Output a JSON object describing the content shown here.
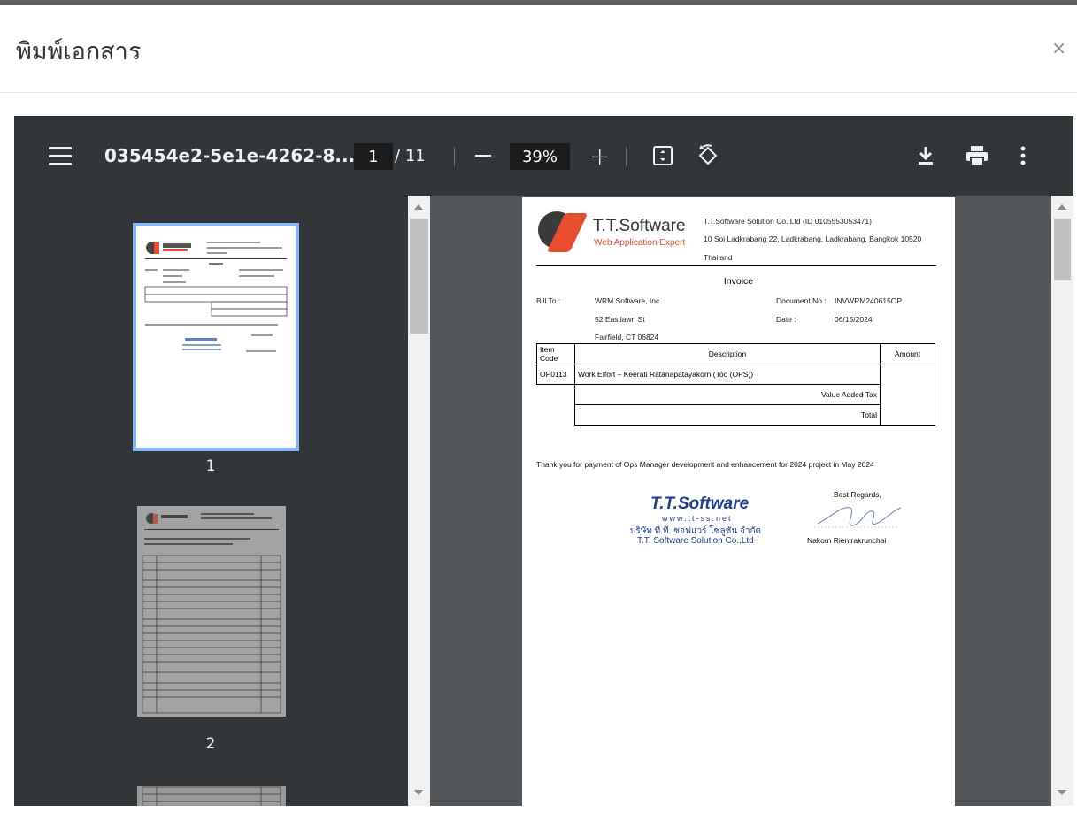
{
  "modal": {
    "title": "พิมพ์เอกสาร",
    "close_label": "×"
  },
  "toolbar": {
    "file_name": "035454e2-5e1e-4262-8...",
    "page_current": "1",
    "page_total": "/ 11",
    "zoom": "39%",
    "zoom_in_label": "+"
  },
  "sidebar": {
    "thumbnails": [
      {
        "label": "1"
      },
      {
        "label": "2"
      }
    ]
  },
  "document": {
    "brand_name": "T.T.Software",
    "brand_tagline": "Web Application Expert",
    "company_line1": "T.T.Software Solution Co.,Ltd (ID 0105553053471)",
    "company_line2": "10 Soi Ladkrabang 22, Ladkrabang, Ladkrabang, Bangkok 10520",
    "company_line3": "Thailand",
    "title": "Invoice",
    "bill_to_label": "Bill To :",
    "bill_to_name": "WRM Software, Inc",
    "bill_to_address1": "52 Eastlawn St",
    "bill_to_address2": "Fairfield, CT 06824",
    "doc_no_label": "Document No :",
    "doc_no": "INVWRM240615OP",
    "date_label": "Date :",
    "date": "06/15/2024",
    "table": {
      "header_code": "Item Code",
      "header_desc": "Description",
      "header_amount": "Amount",
      "row_code": "OP0113",
      "row_desc": "Work Effort – Keerati Ratanapatayakorn (Too (OPS))",
      "vat_label": "Value Added Tax",
      "total_label": "Total"
    },
    "thanks": "Thank you for payment of Ops Manager development and enhancement for 2024 project in May     2024",
    "regards": "Best Regards,",
    "signer": "Nakorn Rientrakrunchai",
    "stamp_brand": "T.T.Software",
    "stamp_url": "www.tt-ss.net",
    "stamp_thai": "บริษัท ที.ที. ซอฟแวร์ โซลูชั่น จำกัด",
    "stamp_en": "T.T. Software Solution Co.,Ltd"
  },
  "colors": {
    "toolbar_bg": "#323639",
    "viewer_bg": "#525659",
    "thumb_highlight": "#8ab4f8",
    "brand_orange": "#e84d2f",
    "stamp_blue": "#1f3c8f"
  }
}
